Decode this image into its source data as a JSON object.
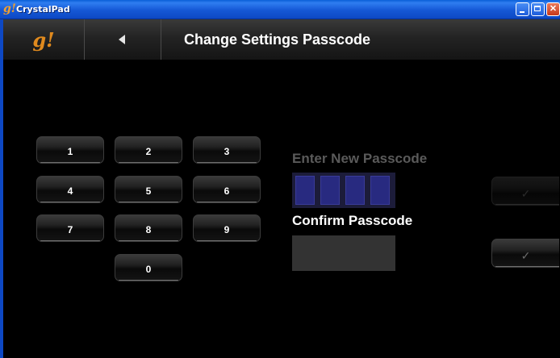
{
  "window": {
    "title": "CrystalPad",
    "icon_text": "g!",
    "controls": {
      "minimize": "minimize-icon",
      "maximize": "maximize-icon",
      "close": "✕"
    }
  },
  "header": {
    "logo": "g!",
    "back_icon": "back-arrow-icon",
    "title": "Change Settings Passcode"
  },
  "keypad": {
    "keys": [
      "1",
      "2",
      "3",
      "4",
      "5",
      "6",
      "7",
      "8",
      "9",
      "0"
    ]
  },
  "passcode": {
    "enter_label": "Enter New Passcode",
    "entered_digit_count": 4,
    "confirm_label": "Confirm Passcode"
  },
  "buttons": {
    "enter_ok_icon": "✓",
    "confirm_ok_icon": "✓",
    "enter_ok_state": "disabled",
    "confirm_ok_state": "enabled"
  },
  "colors": {
    "logo": "#e08a1e",
    "digit_fill": "#282a80",
    "inactive_label": "#5a5a5a"
  }
}
